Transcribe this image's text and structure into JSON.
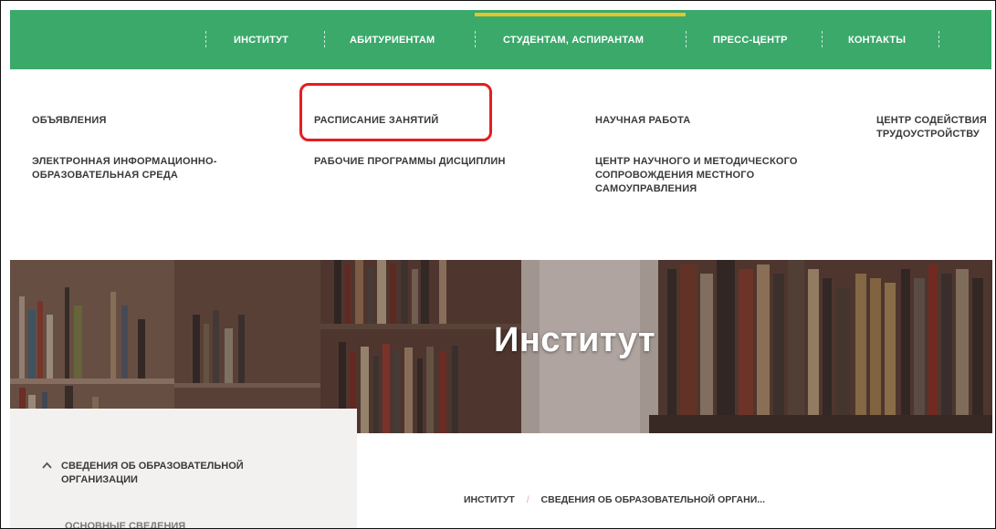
{
  "topnav": {
    "items": [
      {
        "label": "ИНСТИТУТ"
      },
      {
        "label": "АБИТУРИЕНТАМ"
      },
      {
        "label": "СТУДЕНТАМ, АСПИРАНТАМ"
      },
      {
        "label": "ПРЕСС-ЦЕНТР"
      },
      {
        "label": "КОНТАКТЫ"
      }
    ],
    "accent_color": "#e6c42d",
    "bg_color": "#3aa96a"
  },
  "dropdown": {
    "links": [
      {
        "label": "ОБЪЯВЛЕНИЯ"
      },
      {
        "label": "РАСПИСАНИЕ ЗАНЯТИЙ"
      },
      {
        "label": "НАУЧНАЯ РАБОТА"
      },
      {
        "label": "ЦЕНТР СОДЕЙСТВИЯ ТРУДОУСТРОЙСТВУ"
      },
      {
        "label": "ЭЛЕКТРОННАЯ ИНФОРМАЦИОННО-ОБРАЗОВАТЕЛЬНАЯ СРЕДА"
      },
      {
        "label": "РАБОЧИЕ ПРОГРАММЫ ДИСЦИПЛИН"
      },
      {
        "label": "ЦЕНТР НАУЧНОГО И МЕТОДИЧЕСКОГО СОПРОВОЖДЕНИЯ МЕСТНОГО САМОУПРАВЛЕНИЯ"
      }
    ],
    "highlight_color": "#e41e1e"
  },
  "hero": {
    "title": "Институт"
  },
  "sidebar": {
    "heading": "СВЕДЕНИЯ ОБ ОБРАЗОВАТЕЛЬНОЙ ОРГАНИЗАЦИИ",
    "chevron_icon": "chevron-up-icon",
    "sub_item": "ОСНОВНЫЕ СВЕДЕНИЯ"
  },
  "breadcrumb": {
    "items": [
      "ИНСТИТУТ",
      "СВЕДЕНИЯ ОБ ОБРАЗОВАТЕЛЬНОЙ ОРГАНИ..."
    ],
    "separator": "/"
  }
}
